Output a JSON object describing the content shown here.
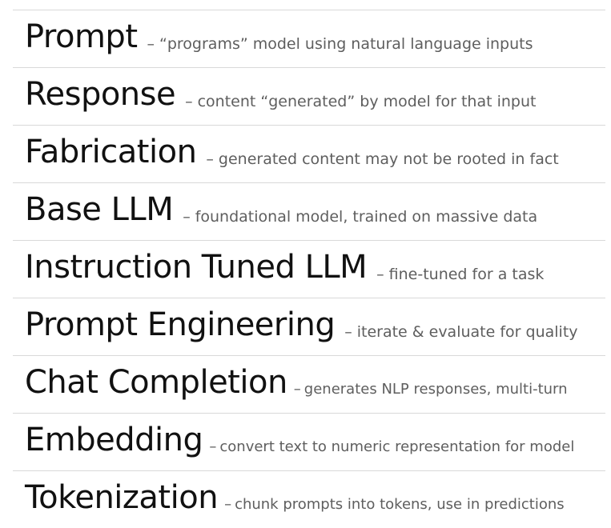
{
  "glossary": {
    "dash": "–",
    "items": [
      {
        "term": "Prompt",
        "definition": "“programs” model using natural language inputs"
      },
      {
        "term": "Response",
        "definition": "content “generated” by model for that input"
      },
      {
        "term": "Fabrication",
        "definition": "generated content may not be rooted in fact"
      },
      {
        "term": "Base LLM",
        "definition": "foundational model, trained on massive data"
      },
      {
        "term": "Instruction Tuned LLM",
        "definition": "fine-tuned for a task"
      },
      {
        "term": "Prompt Engineering",
        "definition": "iterate & evaluate for quality"
      },
      {
        "term": "Chat Completion",
        "definition": "generates NLP responses, multi-turn"
      },
      {
        "term": "Embedding",
        "definition": "convert text to numeric representation for model"
      },
      {
        "term": "Tokenization",
        "definition": "chunk prompts into tokens, use in predictions"
      }
    ]
  }
}
